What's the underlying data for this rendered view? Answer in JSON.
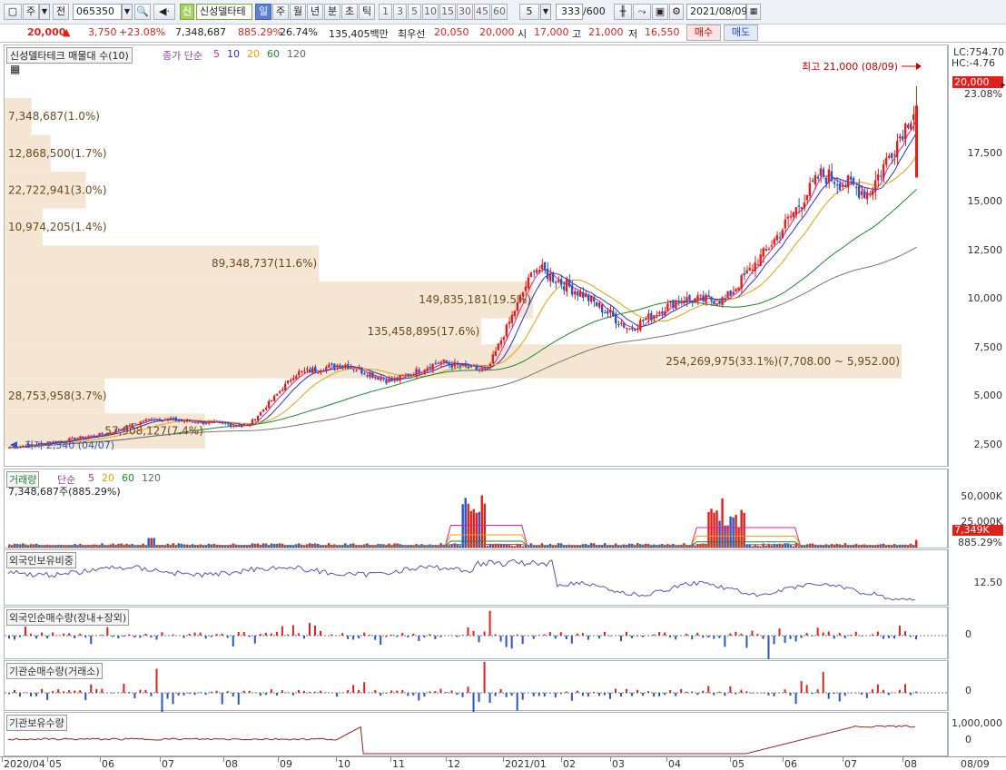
{
  "toolbar": {
    "mode": "주",
    "prev_label": "전",
    "code": "065350",
    "name_badge": "신",
    "stock_name": "신성델타테",
    "periods": [
      "일",
      "주",
      "월",
      "년",
      "분",
      "초",
      "틱"
    ],
    "intervals": [
      "1",
      "3",
      "5",
      "10",
      "15",
      "30",
      "45",
      "60"
    ],
    "custom_interval": "5",
    "count": "333",
    "count_max": "/600",
    "date": "2021/08/09"
  },
  "quote": {
    "price": "20,000",
    "change": "3,750",
    "change_pct": "+23.08%",
    "volume": "7,348,687",
    "volume_ratio": "885.29%",
    "turnover": "26.74%",
    "amount": "135,405백만",
    "priority_label": "최우선",
    "ask": "20,050",
    "bid": "20,000",
    "open_label": "시",
    "open": "17,000",
    "high_label": "고",
    "high": "21,000",
    "low_label": "저",
    "low": "16,550",
    "buy_label": "매수",
    "sell_label": "매도"
  },
  "main_chart": {
    "title": "신성델타테크 매물대 수(10)",
    "ma_label": "종가 단순",
    "ma_periods": [
      "5",
      "10",
      "20",
      "60",
      "120"
    ],
    "ma_colors": [
      "#e0209a",
      "#2233dd",
      "#e8a000",
      "#1a8a2a",
      "#666666"
    ],
    "lc": "LC:754.70",
    "hc": "HC:-4.76",
    "max_note": "최고 21,000 (08/09)",
    "min_note": "최저 2,340 (04/07)",
    "current_price": "20,000",
    "current_pct": "23.08%",
    "y_ticks": [
      "17,500",
      "15,000",
      "12,500",
      "10,000",
      "7,500",
      "5,000",
      "2,500"
    ],
    "volume_profile": [
      {
        "label": "7,348,687(1.0%)",
        "width": 0.01
      },
      {
        "label": "12,868,500(1.7%)",
        "width": 0.017
      },
      {
        "label": "22,722,941(3.0%)",
        "width": 0.03
      },
      {
        "label": "10,974,205(1.4%)",
        "width": 0.014
      },
      {
        "label": "89,348,737(11.6%)",
        "width": 0.116
      },
      {
        "label": "149,835,181(19.5%)",
        "width": 0.195
      },
      {
        "label": "135,458,895(17.6%)",
        "width": 0.176
      },
      {
        "label": "254,269,975(33.1%)(7,708.00 ~ 5,952.00)",
        "width": 0.331
      },
      {
        "label": "28,753,958(3.7%)",
        "width": 0.037
      },
      {
        "label": "57,908,127(7.4%)",
        "width": 0.074
      }
    ]
  },
  "chart_data": {
    "type": "candlestick",
    "title": "신성델타테크 매물대 수(10)",
    "period": "weekly",
    "x_range": [
      "2020/04",
      "2021/08/09"
    ],
    "ylim": [
      2340,
      21000
    ],
    "y_ticks": [
      2500,
      5000,
      7500,
      10000,
      12500,
      15000,
      17500
    ],
    "closes_sampled": [
      {
        "x": "2020/04",
        "y": 2400
      },
      {
        "x": "2020/05",
        "y": 2700
      },
      {
        "x": "2020/06",
        "y": 3100
      },
      {
        "x": "2020/07",
        "y": 3900
      },
      {
        "x": "2020/08",
        "y": 3700
      },
      {
        "x": "2020/09",
        "y": 3500
      },
      {
        "x": "2020/09/late",
        "y": 6200
      },
      {
        "x": "2020/10",
        "y": 6700
      },
      {
        "x": "2020/11",
        "y": 5800
      },
      {
        "x": "2020/12",
        "y": 6800
      },
      {
        "x": "2021/01",
        "y": 6300
      },
      {
        "x": "2021/01/mid",
        "y": 11700
      },
      {
        "x": "2021/02",
        "y": 10300
      },
      {
        "x": "2021/03",
        "y": 8500
      },
      {
        "x": "2021/04",
        "y": 10000
      },
      {
        "x": "2021/05",
        "y": 10000
      },
      {
        "x": "2021/06",
        "y": 13000
      },
      {
        "x": "2021/07",
        "y": 16500
      },
      {
        "x": "2021/08",
        "y": 15500
      },
      {
        "x": "2021/08/09",
        "y": 20000
      }
    ],
    "high": {
      "value": 21000,
      "date": "08/09"
    },
    "low": {
      "value": 2340,
      "date": "04/07"
    },
    "moving_averages": [
      "5",
      "10",
      "20",
      "60",
      "120"
    ]
  },
  "volume_panel": {
    "title": "거래량",
    "ma_label": "단순",
    "ma_periods": [
      "5",
      "20",
      "60",
      "120"
    ],
    "value_text": "7,348,687주(885.29%)",
    "y_ticks": [
      "50,000K",
      "25,000K"
    ],
    "current": "7,349K",
    "current_pct": "885.29%"
  },
  "foreign_ratio_panel": {
    "title": "외국인보유비중",
    "y_tick": "12.50"
  },
  "foreign_net_panel": {
    "title": "외국인순매수량(장내+장외)",
    "y_tick": "0"
  },
  "inst_net_panel": {
    "title": "기관순매수량(거래소)",
    "y_tick": "0"
  },
  "inst_hold_panel": {
    "title": "기관보유수량",
    "y_ticks": [
      "1,000,000",
      "0"
    ]
  },
  "date_axis": [
    "2020/04",
    "05",
    "06",
    "07",
    "08",
    "09",
    "10",
    "11",
    "12",
    "2021/01",
    "02",
    "03",
    "04",
    "05",
    "06",
    "07",
    "08",
    "08/09"
  ],
  "colors": {
    "up": "#e0201a",
    "down": "#2b54c6",
    "profile": "#f5e6d3",
    "profile_text": "#6b4a1e"
  }
}
